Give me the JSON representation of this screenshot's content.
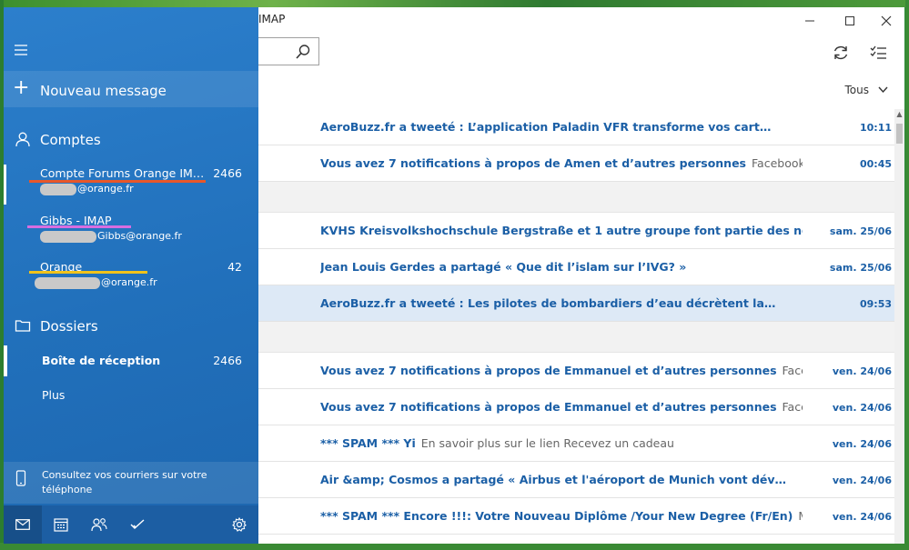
{
  "window": {
    "title": "IMAP"
  },
  "sidebar": {
    "new_message": "Nouveau message",
    "accounts_title": "Comptes",
    "accounts": [
      {
        "name": "Compte Forums Orange IM…",
        "email_suffix": "@orange.fr",
        "count": "2466",
        "underline": "#e8572a"
      },
      {
        "name": "Gibbs - IMAP",
        "email_suffix": "Gibbs@orange.fr",
        "count": "",
        "underline": "#d86de0"
      },
      {
        "name": "Orange",
        "email_suffix": "@orange.fr",
        "count": "42",
        "underline": "#f0c21b"
      }
    ],
    "folders_title": "Dossiers",
    "folders": [
      {
        "label": "Boîte de réception",
        "count": "2466"
      },
      {
        "label": "Plus",
        "count": ""
      }
    ],
    "phone_promo": "Consultez vos courriers sur votre téléphone"
  },
  "list": {
    "filter_label": "Tous",
    "messages": [
      {
        "type": "msg",
        "subject": "AeroBuzz.fr a tweeté : L’application Paladin VFR transforme vos cart…",
        "preview": "",
        "time": "10:11"
      },
      {
        "type": "msg",
        "subject": "Vous avez 7 notifications à propos de Amen et d’autres personnes",
        "preview": "Facebook Emile, consu",
        "time": "00:45"
      },
      {
        "type": "header"
      },
      {
        "type": "msg",
        "subject": "KVHS Kreisvolkshochschule Bergstraße et 1 autre groupe font partie des nouvelles sugge",
        "preview": "",
        "time": "sam. 25/06"
      },
      {
        "type": "msg",
        "subject": "Jean Louis Gerdes a partagé « Que dit l’islam sur l’IVG? »",
        "preview": "",
        "time": "sam. 25/06"
      },
      {
        "type": "msg",
        "subject": "AeroBuzz.fr a tweeté : Les pilotes de bombardiers d’eau décrètent la…",
        "preview": "",
        "time": "09:53",
        "selected": true
      },
      {
        "type": "header"
      },
      {
        "type": "msg",
        "subject": "Vous avez 7 notifications à propos de Emmanuel et d’autres personnes",
        "preview": "Facebook Emile, c",
        "time": "ven. 24/06"
      },
      {
        "type": "msg",
        "subject": "Vous avez 7 notifications à propos de Emmanuel et d’autres personnes",
        "preview": "Facebook Emile, c",
        "time": "ven. 24/06"
      },
      {
        "type": "msg",
        "subject": "*** SPAM *** Yi",
        "preview": "En savoir plus sur le lien Recevez un cadeau",
        "time": "ven. 24/06"
      },
      {
        "type": "msg",
        "subject": "Air &amp; Cosmos a partagé « Airbus et l'aéroport de Munich vont dév…",
        "preview": "",
        "time": "ven. 24/06"
      },
      {
        "type": "msg",
        "subject": "*** SPAM *** Encore !!!:  Votre Nouveau Diplôme /Your New Degree  (Fr/En)",
        "preview": "More than E",
        "time": "ven. 24/06"
      }
    ]
  },
  "colors": {
    "accent": "#1b5fa6",
    "sidebar": "#2170bb",
    "selected_row": "#dde9f6"
  }
}
